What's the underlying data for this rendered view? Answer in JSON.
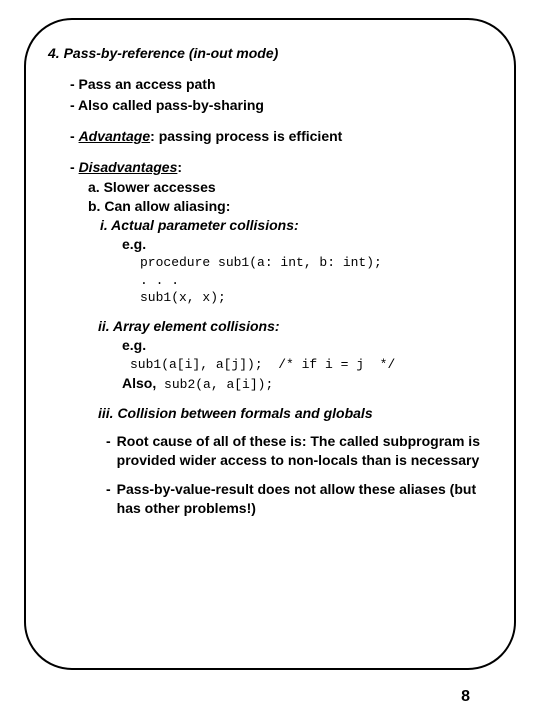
{
  "title": "4. Pass-by-reference (in-out mode)",
  "b1": "- Pass an access path",
  "b2": "- Also called pass-by-sharing",
  "adv_dash": "-",
  "adv_lead": "Advantage",
  "adv_tail": ": passing process is efficient",
  "dis_dash": "-",
  "dis_lead": "Disadvantages",
  "dis_tail": ":",
  "dis_a": "a. Slower accesses",
  "dis_b": "b. Can allow aliasing:",
  "i_head": "i. Actual parameter collisions:",
  "i_eg": "e.g.",
  "i_code1": "procedure sub1(a: int, b: int);",
  "i_code2": ". . .",
  "i_code3": "sub1(x, x);",
  "ii_head": "ii. Array element collisions:",
  "ii_eg": "e.g.",
  "ii_code1": "sub1(a[i], a[j]);  /* if i = j  */",
  "ii_also": "Also,",
  "ii_code2": " sub2(a, a[i]);",
  "iii_head": "iii. Collision between formals and globals",
  "root1_dash": "-",
  "root1": "Root cause of all of these is: The called subprogram is provided wider access to non-locals than is necessary",
  "root2_dash": "-",
  "root2": "Pass-by-value-result does not allow these aliases (but has other problems!)",
  "page": "8"
}
